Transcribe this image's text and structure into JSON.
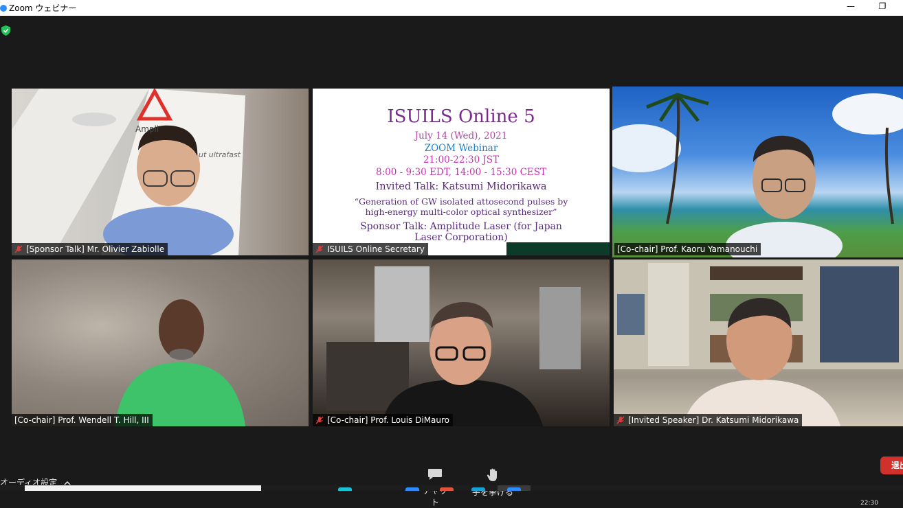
{
  "window": {
    "title": "Zoom ウェビナー",
    "minimize_glyph": "—",
    "restore_glyph": "❐"
  },
  "tiles": [
    {
      "name": "[Sponsor Talk] Mr. Olivier Zabiolle",
      "muted": true,
      "active": false
    },
    {
      "name": "ISUILS Online Secretary",
      "muted": true,
      "active": false
    },
    {
      "name": "[Co-chair] Prof. Kaoru Yamanouchi",
      "muted": false,
      "active": true
    },
    {
      "name": "[Co-chair] Prof. Wendell T. Hill, III",
      "muted": false,
      "active": false
    },
    {
      "name": "[Co-chair] Prof. Louis DiMauro",
      "muted": true,
      "active": false
    },
    {
      "name": "[Invited Speaker] Dr. Katsumi Midorikawa",
      "muted": true,
      "active": false
    }
  ],
  "slide": {
    "title": "ISUILS Online 5",
    "date": "July 14 (Wed), 2021",
    "venue": "ZOOM Webinar",
    "time_jst": "21:00-22:30 JST",
    "time_other": "8:00 - 9:30 EDT, 14:00 - 15:30 CEST",
    "invited_talk": "Invited Talk:  Katsumi Midorikawa",
    "talk_title_1": "“Generation of GW isolated attosecond pulses by",
    "talk_title_2": "high-energy multi-color optical synthesizer”",
    "sponsor_talk_1": "Sponsor Talk: Amplitude Laser (for Japan",
    "sponsor_talk_2": "Laser Corporation)"
  },
  "sponsor_backdrop": {
    "brand": "Ampli",
    "tagline": "ut ultrafast"
  },
  "toolbar": {
    "audio_settings": "オーディオ設定",
    "chat": "チャット",
    "raise_hand": "手を挙げる",
    "leave": "退出",
    "clock": "22:30"
  },
  "colors": {
    "active_speaker": "#c8e65a",
    "leave_button": "#d0312d",
    "mute_icon": "#e23b3b"
  },
  "icons": {
    "shield": "security-shield-icon",
    "mic_off": "microphone-muted-icon",
    "chat": "chat-bubble-icon",
    "raise_hand": "hand-icon",
    "chevron": "chevron-up-icon"
  }
}
